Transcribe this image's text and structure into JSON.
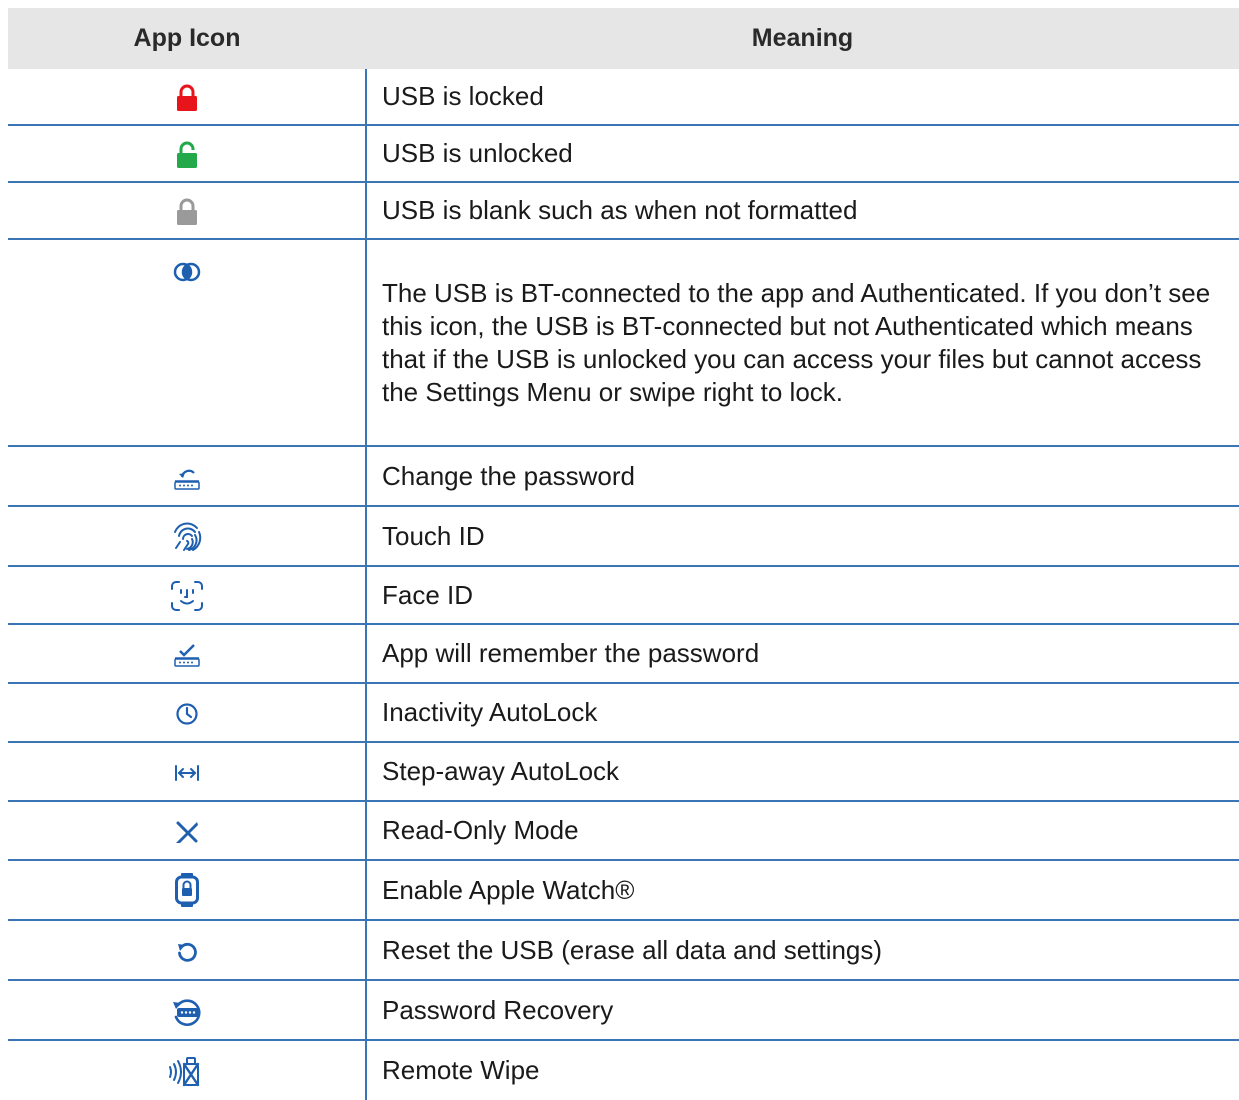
{
  "table": {
    "headers": {
      "icon": "App Icon",
      "meaning": "Meaning"
    },
    "rows": [
      {
        "icon": "lock-locked-icon",
        "meaning": "USB is locked"
      },
      {
        "icon": "lock-unlocked-icon",
        "meaning": "USB is unlocked"
      },
      {
        "icon": "lock-blank-icon",
        "meaning": "USB is blank such as when not formatted"
      },
      {
        "icon": "authenticated-icon",
        "meaning": "The USB is BT-connected to the app and Authenticated. If you don’t see this icon, the USB is BT-connected but not Authenticated which means that if the USB is unlocked you can access your files but cannot access the Settings Menu or swipe right to lock."
      },
      {
        "icon": "change-password-icon",
        "meaning": "Change the password"
      },
      {
        "icon": "fingerprint-icon",
        "meaning": "Touch ID"
      },
      {
        "icon": "face-id-icon",
        "meaning": "Face ID"
      },
      {
        "icon": "remember-password-icon",
        "meaning": "App will remember the password"
      },
      {
        "icon": "clock-icon",
        "meaning": "Inactivity AutoLock"
      },
      {
        "icon": "step-away-icon",
        "meaning": "Step-away AutoLock"
      },
      {
        "icon": "read-only-icon",
        "meaning": "Read-Only Mode"
      },
      {
        "icon": "apple-watch-icon",
        "meaning": "Enable Apple Watch®"
      },
      {
        "icon": "reset-icon",
        "meaning": "Reset the USB (erase all data and settings)"
      },
      {
        "icon": "password-recovery-icon",
        "meaning": "Password Recovery"
      },
      {
        "icon": "remote-wipe-icon",
        "meaning": "Remote Wipe"
      }
    ]
  },
  "colors": {
    "header_background": "#e6e6e6",
    "grid_line": "#3c75b5",
    "lock_locked": "#e8141c",
    "lock_unlocked": "#23a84a",
    "lock_blank": "#9a9a9a",
    "icon_blue": "#1e5fb0"
  }
}
